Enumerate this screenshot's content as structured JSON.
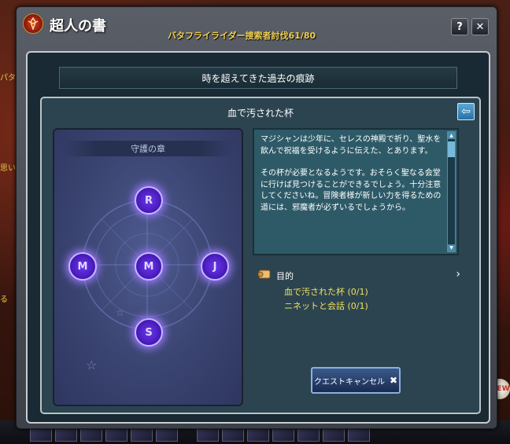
{
  "window": {
    "title": "超人の書",
    "quest_progress": "バタフライライダー捜索者討伐61/80",
    "help_button": "?",
    "close_button": "✕"
  },
  "background": {
    "left_text_1": "パタブ",
    "left_text_2": "思い",
    "left_text_3": "る",
    "new_badge": "NEW"
  },
  "section_title": "時を超えてきた過去の痕跡",
  "quest": {
    "title": "血で汚された杯",
    "back_icon": "back-arrow-icon"
  },
  "rune_panel": {
    "header": "守護の章",
    "runes": [
      "R",
      "M",
      "M",
      "J",
      "S"
    ]
  },
  "description": {
    "paragraph_1": "マジシャンは少年に、セレスの神殿で祈り、聖水を飲んで祝福を受けるように伝えた、とあります。",
    "paragraph_2": "その杯が必要となるようです。おそらく聖なる会堂に行けば見つけることができるでしょう。十分注意してくださいね。冒険者様が新しい力を得るための道には、邪魔者が必ずいるでしょうから。"
  },
  "objective": {
    "label": "目的",
    "items": [
      "血で汚された杯 (0/1)",
      "ニネットと会話 (0/1)"
    ]
  },
  "cancel_button": {
    "label": "クエストキャンセル",
    "icon": "✖"
  },
  "colors": {
    "accent": "#f0e060",
    "title_gold": "#f0d050",
    "rune_glow": "#9a78ff"
  }
}
